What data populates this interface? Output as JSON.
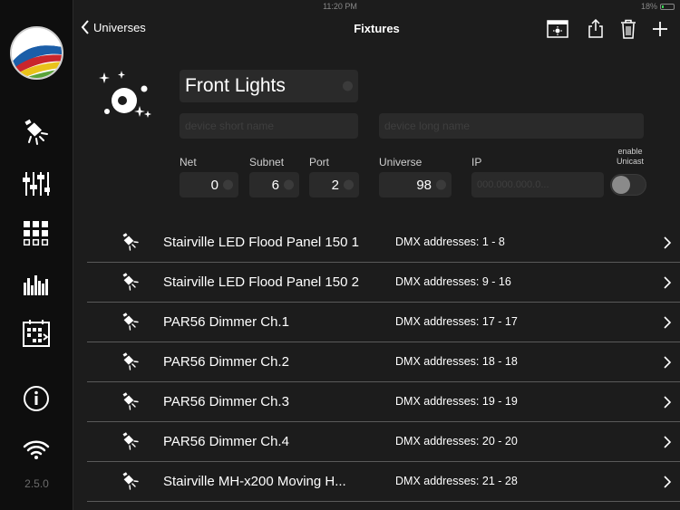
{
  "status": {
    "time": "11:20 PM",
    "battery": "18%"
  },
  "app": {
    "version": "2.5.0"
  },
  "sidebar": {
    "items": [
      {
        "icon": "fixture-light-icon"
      },
      {
        "icon": "faders-icon"
      },
      {
        "icon": "grid-icon"
      },
      {
        "icon": "levels-icon"
      },
      {
        "icon": "scenes-icon"
      },
      {
        "icon": "info-icon"
      },
      {
        "icon": "wifi-icon"
      }
    ]
  },
  "navbar": {
    "back_label": "Universes",
    "title": "Fixtures"
  },
  "universe": {
    "name": "Front Lights",
    "short_name_placeholder": "device short name",
    "long_name_placeholder": "device long name",
    "labels": {
      "net": "Net",
      "subnet": "Subnet",
      "port": "Port",
      "universe": "Universe",
      "ip": "IP",
      "unicast_line1": "enable",
      "unicast_line2": "Unicast"
    },
    "net": "0",
    "subnet": "6",
    "port": "2",
    "universe": "98",
    "ip_placeholder": "000.000.000.0...",
    "unicast_enabled": false
  },
  "fixtures": [
    {
      "name": "Stairville LED Flood Panel 150 1",
      "dmx": "DMX addresses: 1 - 8"
    },
    {
      "name": "Stairville LED Flood Panel 150 2",
      "dmx": "DMX addresses: 9 - 16"
    },
    {
      "name": "PAR56 Dimmer Ch.1",
      "dmx": "DMX addresses: 17 - 17"
    },
    {
      "name": "PAR56 Dimmer Ch.2",
      "dmx": "DMX addresses: 18 - 18"
    },
    {
      "name": "PAR56 Dimmer Ch.3",
      "dmx": "DMX addresses: 19 - 19"
    },
    {
      "name": "PAR56 Dimmer Ch.4",
      "dmx": "DMX addresses: 20 - 20"
    },
    {
      "name": "Stairville MH-x200 Moving H...",
      "dmx": "DMX addresses: 21 - 28"
    }
  ],
  "colors": {
    "background": "#1c1c1c",
    "sidebar": "#0e0e0e",
    "field": "#2a2a2a",
    "divider": "#5a5a5a"
  }
}
